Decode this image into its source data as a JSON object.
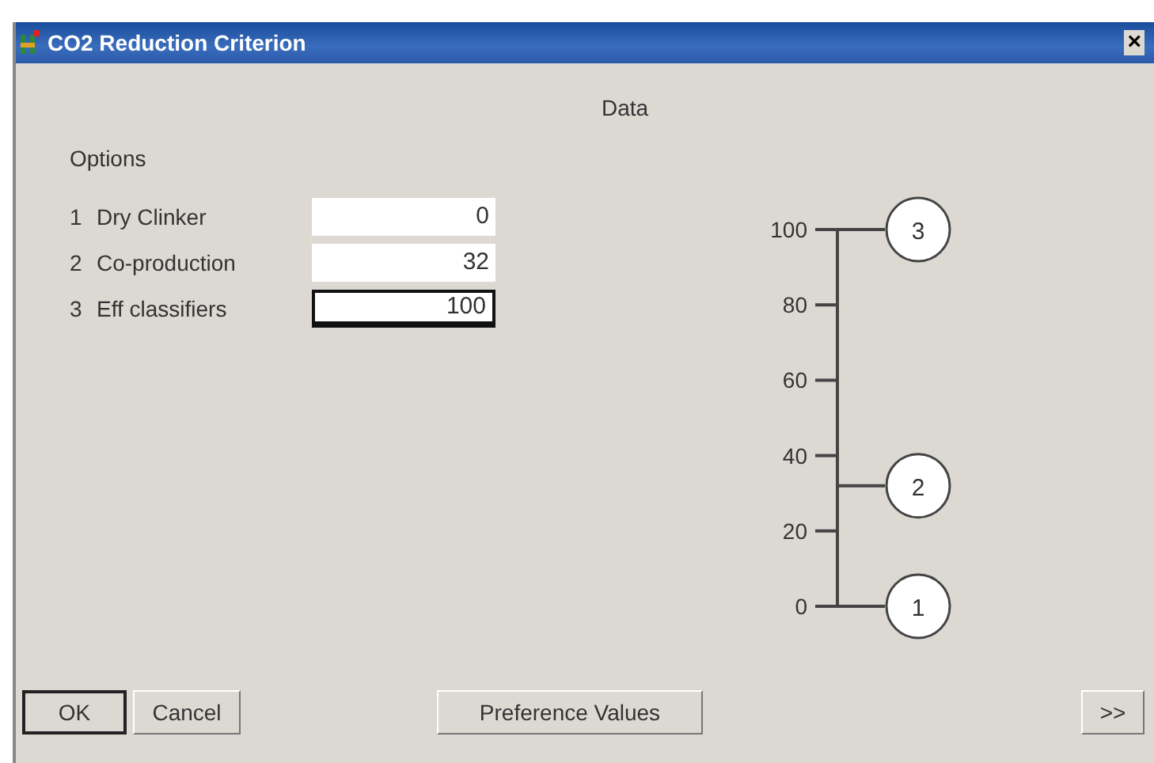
{
  "window": {
    "title": "CO2 Reduction Criterion",
    "close": "×"
  },
  "options": {
    "heading": "Options",
    "items": [
      {
        "number": "1",
        "name": "Dry Clinker",
        "value": "0",
        "focused": false
      },
      {
        "number": "2",
        "name": "Co-production",
        "value": "32",
        "focused": false
      },
      {
        "number": "3",
        "name": "Eff classifiers",
        "value": "100",
        "focused": true
      }
    ]
  },
  "data": {
    "heading": "Data",
    "ticks": [
      "100",
      "80",
      "60",
      "40",
      "20",
      "0"
    ],
    "points": [
      {
        "label": "3"
      },
      {
        "label": "2"
      },
      {
        "label": "1"
      }
    ]
  },
  "buttons": [
    {
      "label": "OK",
      "default": true
    },
    {
      "label": "Cancel",
      "default": false
    },
    {
      "label": "Preference Values",
      "default": false
    },
    {
      "label": ">>",
      "default": false
    }
  ]
}
